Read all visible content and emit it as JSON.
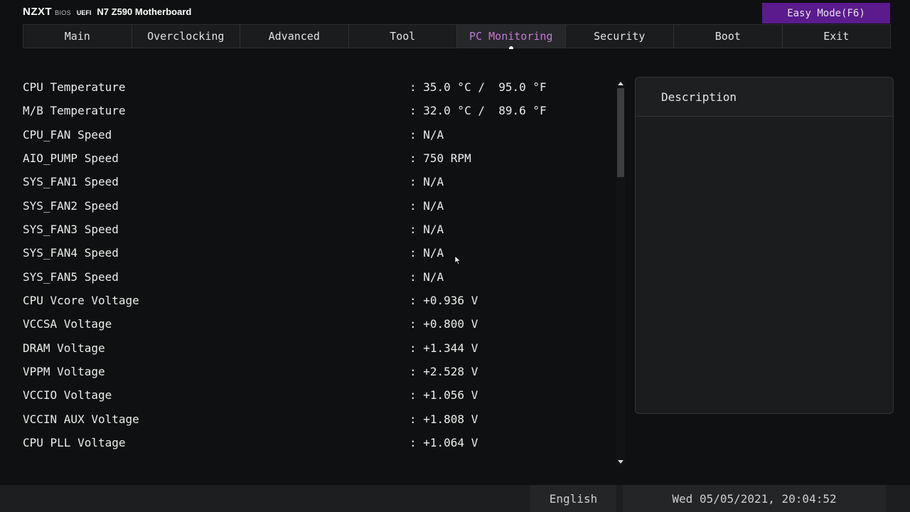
{
  "header": {
    "logo": "NZXT",
    "bios_text": "BIOS",
    "uefi_text": "UEFI",
    "board_name": "N7 Z590 Motherboard",
    "easy_mode_button": "Easy Mode(F6)",
    "accent_color": "#5a1b8c"
  },
  "tabs": [
    {
      "label": "Main"
    },
    {
      "label": "Overclocking"
    },
    {
      "label": "Advanced"
    },
    {
      "label": "Tool"
    },
    {
      "label": "PC Monitoring",
      "active": true
    },
    {
      "label": "Security"
    },
    {
      "label": "Boot"
    },
    {
      "label": "Exit"
    }
  ],
  "active_tab_color": "#c17ad6",
  "monitor": {
    "rows": [
      {
        "label": "CPU Temperature",
        "value": ": 35.0 °C /  95.0 °F"
      },
      {
        "label": "M/B Temperature",
        "value": ": 32.0 °C /  89.6 °F"
      },
      {
        "label": "CPU_FAN Speed",
        "value": ": N/A"
      },
      {
        "label": "AIO_PUMP Speed",
        "value": ": 750 RPM"
      },
      {
        "label": "SYS_FAN1 Speed",
        "value": ": N/A"
      },
      {
        "label": "SYS_FAN2 Speed",
        "value": ": N/A"
      },
      {
        "label": "SYS_FAN3 Speed",
        "value": ": N/A"
      },
      {
        "label": "SYS_FAN4 Speed",
        "value": ": N/A"
      },
      {
        "label": "SYS_FAN5 Speed",
        "value": ": N/A"
      },
      {
        "label": "CPU Vcore Voltage",
        "value": ": +0.936 V"
      },
      {
        "label": "VCCSA Voltage",
        "value": ": +0.800 V"
      },
      {
        "label": "DRAM Voltage",
        "value": ": +1.344 V"
      },
      {
        "label": "VPPM Voltage",
        "value": ": +2.528 V"
      },
      {
        "label": "VCCIO Voltage",
        "value": ": +1.056 V"
      },
      {
        "label": "VCCIN AUX Voltage",
        "value": ": +1.808 V"
      },
      {
        "label": "CPU PLL Voltage",
        "value": ": +1.064 V"
      }
    ]
  },
  "description": {
    "title": "Description"
  },
  "footer": {
    "language": "English",
    "datetime": "Wed 05/05/2021, 20:04:52"
  },
  "icons": {
    "scroll_up": "chevron-up-icon",
    "scroll_down": "chevron-down-icon",
    "pointer": "mouse-pointer-icon"
  }
}
